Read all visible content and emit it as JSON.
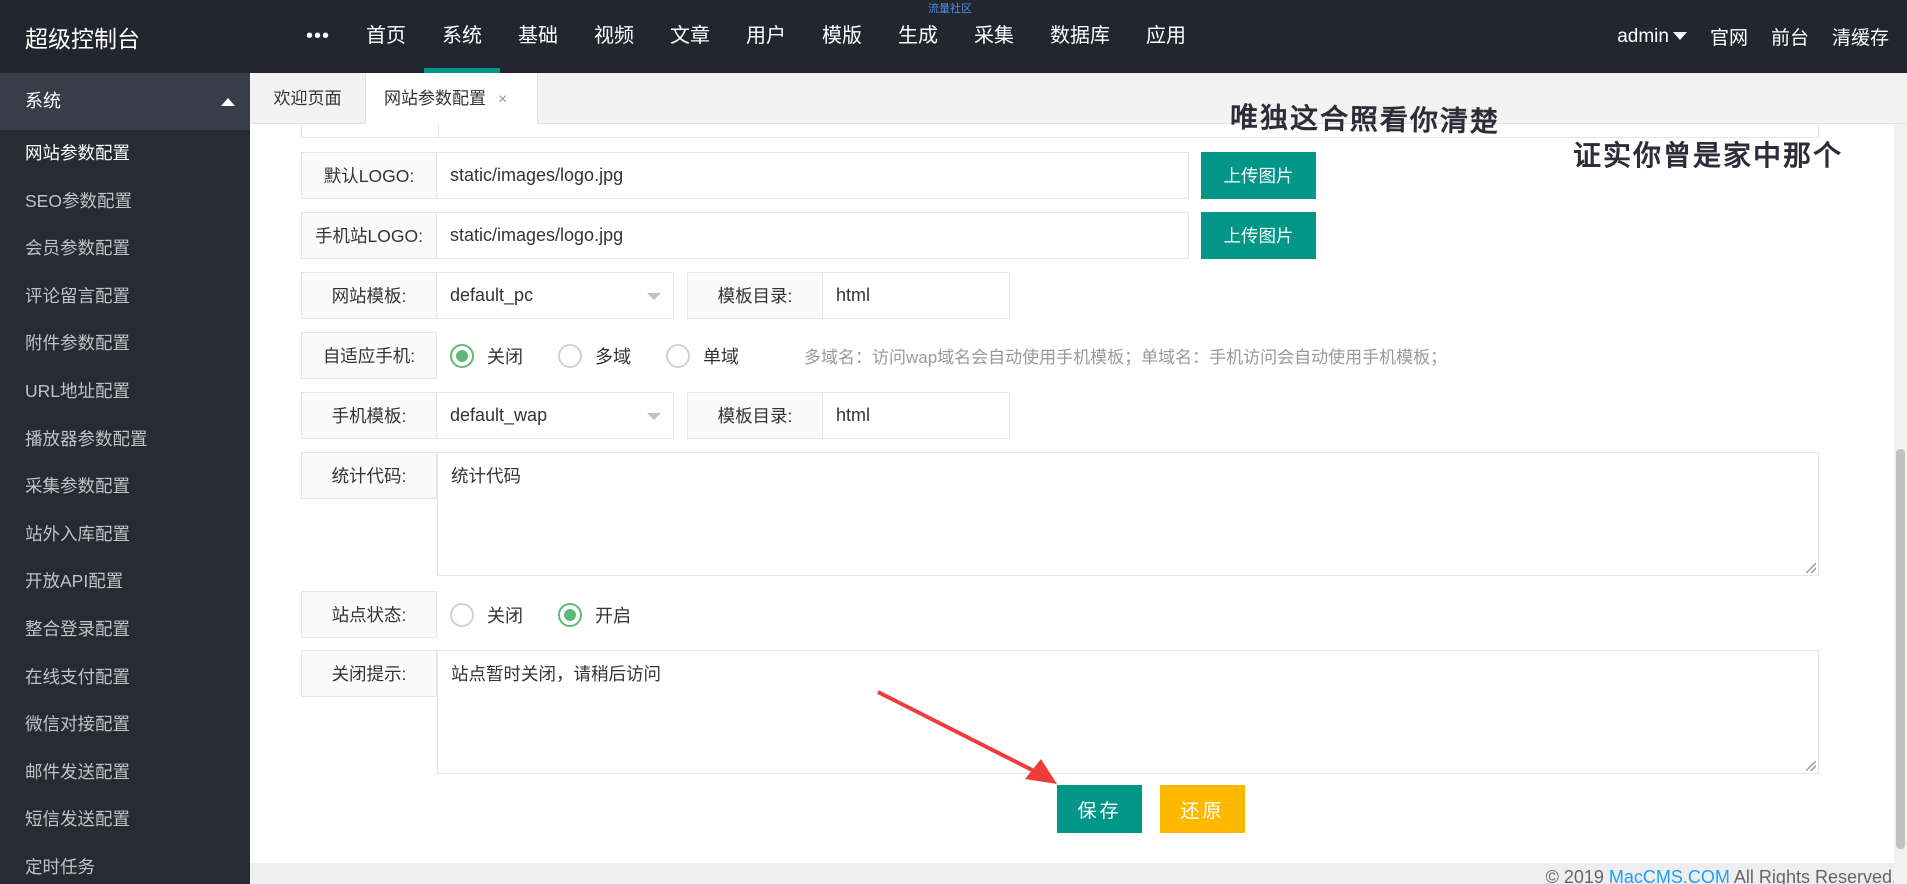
{
  "topbar": {
    "brand": "超级控制台",
    "tiny_tag": "流量社区",
    "more": "•••",
    "nav": [
      "首页",
      "系统",
      "基础",
      "视频",
      "文章",
      "用户",
      "模版",
      "生成",
      "采集",
      "数据库",
      "应用"
    ],
    "active_nav": "系统",
    "user": "admin",
    "links": [
      "官网",
      "前台",
      "清缓存"
    ]
  },
  "sidebar": {
    "header": "系统",
    "items": [
      "网站参数配置",
      "SEO参数配置",
      "会员参数配置",
      "评论留言配置",
      "附件参数配置",
      "URL地址配置",
      "播放器参数配置",
      "采集参数配置",
      "站外入库配置",
      "开放API配置",
      "整合登录配置",
      "在线支付配置",
      "微信对接配置",
      "邮件发送配置",
      "短信发送配置",
      "定时任务"
    ]
  },
  "tabs": {
    "welcome": "欢迎页面",
    "current": "网站参数配置",
    "close": "×"
  },
  "form": {
    "logo_label": "默认LOGO:",
    "logo_value": "static/images/logo.jpg",
    "mobile_logo_label": "手机站LOGO:",
    "mobile_logo_value": "static/images/logo.jpg",
    "upload_label": "上传图片",
    "template_label": "网站模板:",
    "template_value": "default_pc",
    "dir_label": "模板目录:",
    "dir_value": "html",
    "adaptive_label": "自适应手机:",
    "adaptive_options": [
      "关闭",
      "多域",
      "单域"
    ],
    "adaptive_selected": "关闭",
    "adaptive_hint": "多域名：访问wap域名会自动使用手机模板；单域名：手机访问会自动使用手机模板；",
    "mobile_template_label": "手机模板:",
    "mobile_template_value": "default_wap",
    "mobile_dir_label": "模板目录:",
    "mobile_dir_value": "html",
    "stats_label": "统计代码:",
    "stats_value": "统计代码",
    "status_label": "站点状态:",
    "status_options": [
      "关闭",
      "开启"
    ],
    "status_selected": "开启",
    "close_tip_label": "关闭提示:",
    "close_tip_value": "站点暂时关闭，请稍后访问",
    "save": "保存",
    "reset": "还原"
  },
  "footer": {
    "prefix": "© 2019 ",
    "link": "MacCMS.COM",
    "suffix": " All Rights Reserved."
  },
  "overlay": {
    "line1": "唯独这合照看你清楚",
    "line2": "证实你曾是家中那个"
  },
  "colors": {
    "primary": "#009688",
    "warning": "#ffb800",
    "radio_on": "#5fb878",
    "topbar": "#23262e",
    "sidebar": "#282b33",
    "arrow": "#f03c3c"
  }
}
